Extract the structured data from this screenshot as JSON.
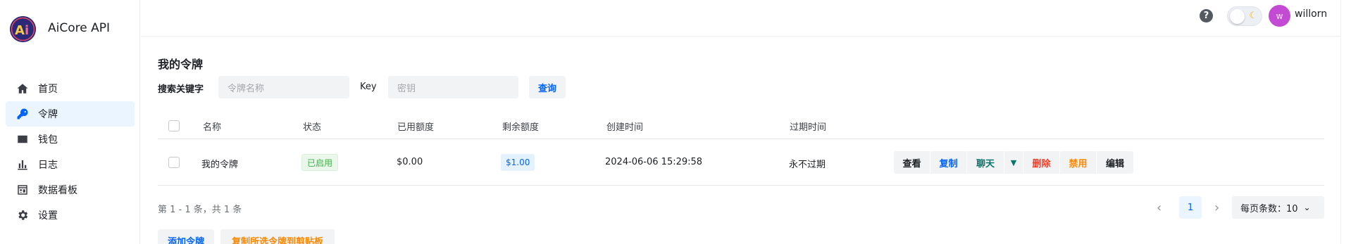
{
  "brand": {
    "name": "AiCore API",
    "logo_text": "Ai"
  },
  "sidebar": {
    "items": [
      {
        "label": "首页",
        "icon": "home-icon"
      },
      {
        "label": "令牌",
        "icon": "key-icon",
        "active": true
      },
      {
        "label": "钱包",
        "icon": "wallet-icon"
      },
      {
        "label": "日志",
        "icon": "bar-chart-icon"
      },
      {
        "label": "数据看板",
        "icon": "dashboard-icon"
      },
      {
        "label": "设置",
        "icon": "gear-icon"
      }
    ]
  },
  "header": {
    "help_glyph": "?",
    "user": {
      "avatar_letter": "w",
      "name": "willorn"
    }
  },
  "page": {
    "title": "我的令牌",
    "search_label": "搜索关键字",
    "name_placeholder": "令牌名称",
    "key_label": "Key",
    "key_placeholder": "密钥",
    "query_button": "查询"
  },
  "table": {
    "columns": [
      "名称",
      "状态",
      "已用额度",
      "剩余额度",
      "创建时间",
      "过期时间"
    ],
    "rows": [
      {
        "name": "我的令牌",
        "status": "已启用",
        "used": "$0.00",
        "remaining": "$1.00",
        "created": "2024-06-06 15:29:58",
        "expires": "永不过期"
      }
    ],
    "actions": {
      "view": "查看",
      "copy": "复制",
      "chat": "聊天",
      "delete": "删除",
      "disable": "禁用",
      "edit": "编辑"
    }
  },
  "footer": {
    "summary": "第 1 - 1 条，共 1 条",
    "current_page": "1",
    "page_size_label": "每页条数：10",
    "add_button": "添加令牌",
    "copy_selected_button": "复制所选令牌到剪贴板"
  },
  "colors": {
    "accent": "#0064fa",
    "active_bg": "#eaf5ff",
    "success": "#3bb346",
    "danger": "#f93920",
    "warning": "#fc8800",
    "teal": "#097667",
    "avatar": "#c34bd4"
  }
}
